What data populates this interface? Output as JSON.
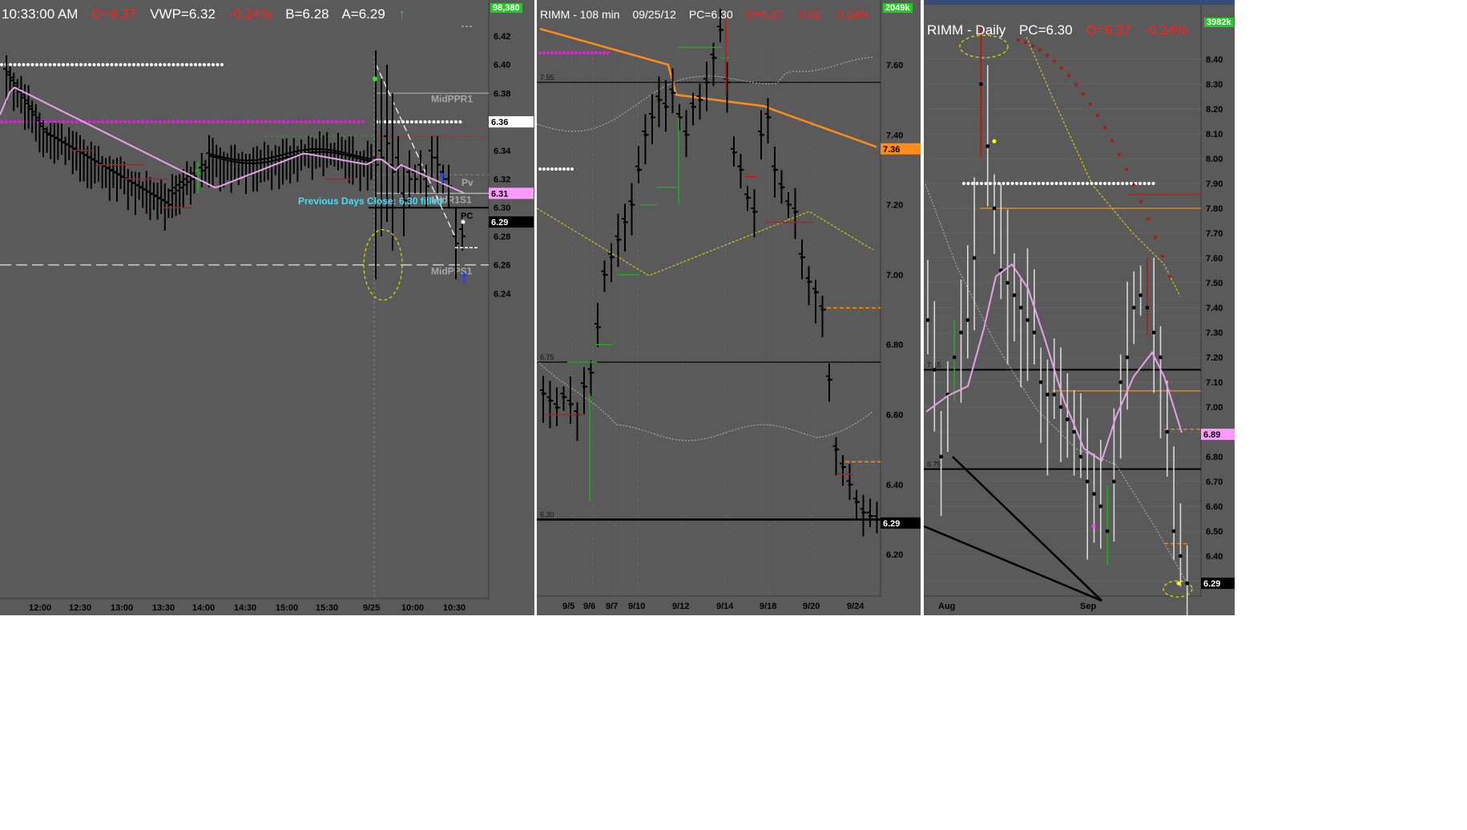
{
  "panels": {
    "intraday": {
      "header": {
        "time": "10:33:00 AM",
        "open": "O=6.37",
        "vwap": "VWP=6.32",
        "change": "-0.24%",
        "bid": "B=6.28",
        "ask": "A=6.29"
      },
      "volume_badge": "98,380",
      "price_ticks": [
        "6.42",
        "6.40",
        "6.38",
        "6.36",
        "6.34",
        "6.32",
        "6.30",
        "6.28",
        "6.26",
        "6.24"
      ],
      "time_ticks": [
        "12:00",
        "12:30",
        "13:00",
        "13:30",
        "14:00",
        "14:30",
        "15:00",
        "15:30",
        "9/25",
        "10:00",
        "10:30"
      ],
      "price_tags": {
        "white": "6.36",
        "pink": "6.31",
        "black": "6.29"
      },
      "level_labels": {
        "midppr1": "MidPPR1",
        "pv": "Pv",
        "midr1s1": "MidR1S1",
        "midpps1": "MidPPS1",
        "pc": "PC"
      },
      "annotation": "Previous Days Close: 6.30 filled"
    },
    "min108": {
      "header": {
        "title": "RIMM - 108 min",
        "date": "09/25/12",
        "prev_close": "PC=6.30",
        "open": "O=6.37",
        "change_abs": "-0.02",
        "change_pct": "-0.24%"
      },
      "volume_badge": "2049k",
      "price_ticks": [
        "7.60",
        "7.40",
        "7.20",
        "7.00",
        "6.80",
        "6.60",
        "6.40",
        "6.20"
      ],
      "date_ticks": [
        "9/5",
        "9/6",
        "9/7",
        "9/10",
        "9/12",
        "9/14",
        "9/18",
        "9/20",
        "9/24"
      ],
      "price_tags": {
        "orange": "7.36",
        "black": "6.29"
      },
      "level_labels": {
        "l755": "7.55",
        "l675": "6.75",
        "l630": "6.30"
      }
    },
    "daily": {
      "header": {
        "title": "RIMM - Daily",
        "prev_close": "PC=6.30",
        "open": "O=6.37",
        "change_pct": "-0.24%"
      },
      "volume_badge": "3982k",
      "price_ticks": [
        "8.40",
        "8.30",
        "8.20",
        "8.10",
        "8.00",
        "7.90",
        "7.80",
        "7.70",
        "7.60",
        "7.50",
        "7.40",
        "7.30",
        "7.20",
        "7.10",
        "7.00",
        "6.90",
        "6.80",
        "6.70",
        "6.60",
        "6.50",
        "6.40",
        "6.30"
      ],
      "month_ticks": [
        "Aug",
        "Sep"
      ],
      "price_tags": {
        "pink": "6.89",
        "black": "6.29"
      },
      "level_labels": {
        "l715": "7.15",
        "l675": "6.75"
      }
    }
  },
  "colors": {
    "panel_bg": "#5a5a5a",
    "pink_ma": "#e8a0e8",
    "magenta_dots": "#e020e0",
    "orange_ma": "#ff8c1a",
    "yellow_band": "#e0e000",
    "green_badge": "#22cc22",
    "red_text": "#ff2020",
    "cyan_text": "#40e0ff"
  },
  "chart_data": [
    {
      "type": "bar",
      "subtype": "ohlc-intraday",
      "symbol": "RIMM",
      "ylim": [
        6.23,
        6.43
      ],
      "x": [
        "11:45",
        "12:00",
        "12:15",
        "12:30",
        "12:45",
        "13:00",
        "13:15",
        "13:30",
        "13:45",
        "14:00",
        "14:15",
        "14:30",
        "14:45",
        "15:00",
        "15:15",
        "15:30",
        "15:45",
        "9/25 9:30",
        "9:45",
        "10:00",
        "10:15",
        "10:30"
      ],
      "series": [
        {
          "name": "close",
          "values": [
            6.38,
            6.37,
            6.36,
            6.35,
            6.34,
            6.33,
            6.33,
            6.32,
            6.31,
            6.31,
            6.32,
            6.34,
            6.34,
            6.34,
            6.34,
            6.33,
            6.31,
            6.34,
            6.33,
            6.32,
            6.32,
            6.29
          ]
        },
        {
          "name": "VWAP",
          "values": [
            6.38,
            6.37,
            6.36,
            6.35,
            6.34,
            6.33,
            6.33,
            6.32,
            6.32,
            6.31,
            6.32,
            6.33,
            6.33,
            6.33,
            6.33,
            6.33,
            6.32,
            6.33,
            6.33,
            6.33,
            6.32,
            6.31
          ]
        }
      ],
      "levels": {
        "MidPPR1": 6.38,
        "Pv": 6.323,
        "MidR1S1": 6.31,
        "PC": 6.3,
        "MidPPS1": 6.26
      }
    },
    {
      "type": "bar",
      "subtype": "ohlc-108min",
      "symbol": "RIMM",
      "ylim": [
        6.13,
        7.75
      ],
      "x": [
        "9/5",
        "9/6",
        "9/7",
        "9/10",
        "9/12",
        "9/14",
        "9/18",
        "9/20",
        "9/24"
      ],
      "series": [
        {
          "name": "close",
          "values": [
            6.65,
            6.6,
            6.75,
            7.05,
            7.45,
            7.5,
            7.25,
            6.95,
            6.32
          ]
        },
        {
          "name": "MA",
          "values": [
            7.65,
            7.58,
            7.52,
            7.49,
            7.48,
            7.47,
            7.45,
            7.41,
            7.36
          ]
        }
      ],
      "levels": {
        "7.55": 7.55,
        "6.75": 6.75,
        "6.30": 6.3
      }
    },
    {
      "type": "bar",
      "subtype": "ohlc-daily",
      "symbol": "RIMM",
      "ylim": [
        6.24,
        8.5
      ],
      "x": [
        "Aug",
        "Sep"
      ],
      "series": [
        {
          "name": "close",
          "values": [
            7.35,
            6.8,
            7.2,
            8.05,
            7.55,
            7.4,
            7.0,
            6.7,
            6.55,
            7.2,
            7.45,
            6.91,
            6.29
          ]
        }
      ],
      "levels": {
        "7.15": 7.15,
        "6.75": 6.75
      }
    }
  ]
}
